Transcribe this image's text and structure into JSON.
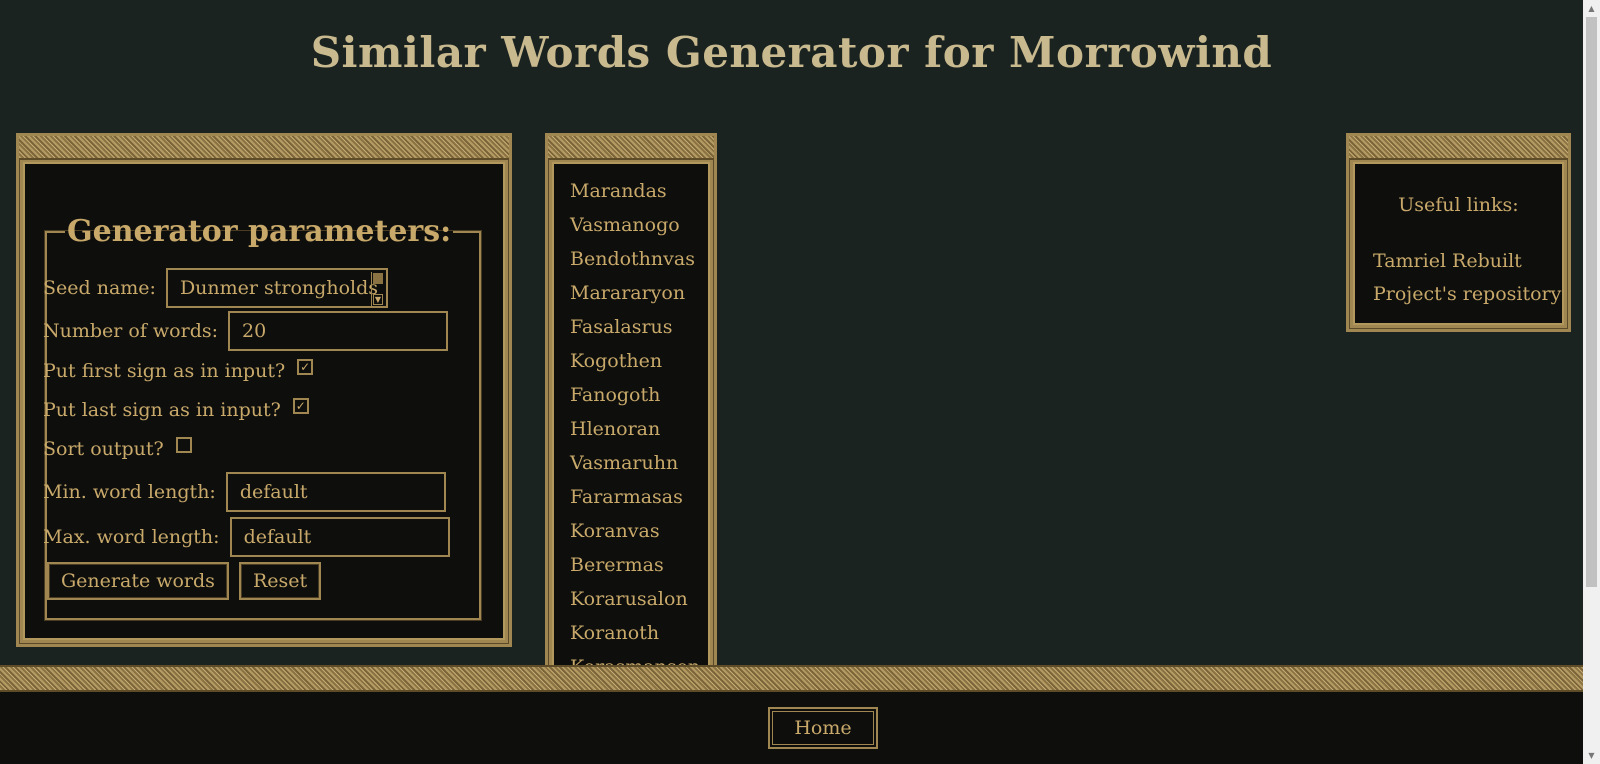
{
  "page": {
    "title": "Similar Words Generator for Morrowind"
  },
  "params": {
    "legend": "Generator parameters:",
    "seed_label": "Seed name:",
    "seed_value": "Dunmer strongholds",
    "num_words_label": "Number of words:",
    "num_words_value": "20",
    "first_sign_label": "Put first sign as in input?",
    "first_sign_checked": true,
    "last_sign_label": "Put last sign as in input?",
    "last_sign_checked": true,
    "sort_label": "Sort output?",
    "sort_checked": false,
    "min_len_label": "Min. word length:",
    "min_len_value": "default",
    "max_len_label": "Max. word length:",
    "max_len_value": "default",
    "generate_label": "Generate words",
    "reset_label": "Reset"
  },
  "words": [
    "Marandas",
    "Vasmanogo",
    "Bendothnvas",
    "Marararyon",
    "Fasalasrus",
    "Kogothen",
    "Fanogoth",
    "Hlenoran",
    "Vasmaruhn",
    "Fararmasas",
    "Koranvas",
    "Berermas",
    "Korarusalon",
    "Koranoth",
    "Korasmansen"
  ],
  "links": {
    "title": "Useful links:",
    "items": [
      "Tamriel Rebuilt",
      "Project's repository"
    ]
  },
  "footer": {
    "home_label": "Home"
  },
  "colors": {
    "background": "#1a2320",
    "gold_text": "#c8a96a",
    "panel": "#0e0e0d",
    "border": "#a08650"
  }
}
